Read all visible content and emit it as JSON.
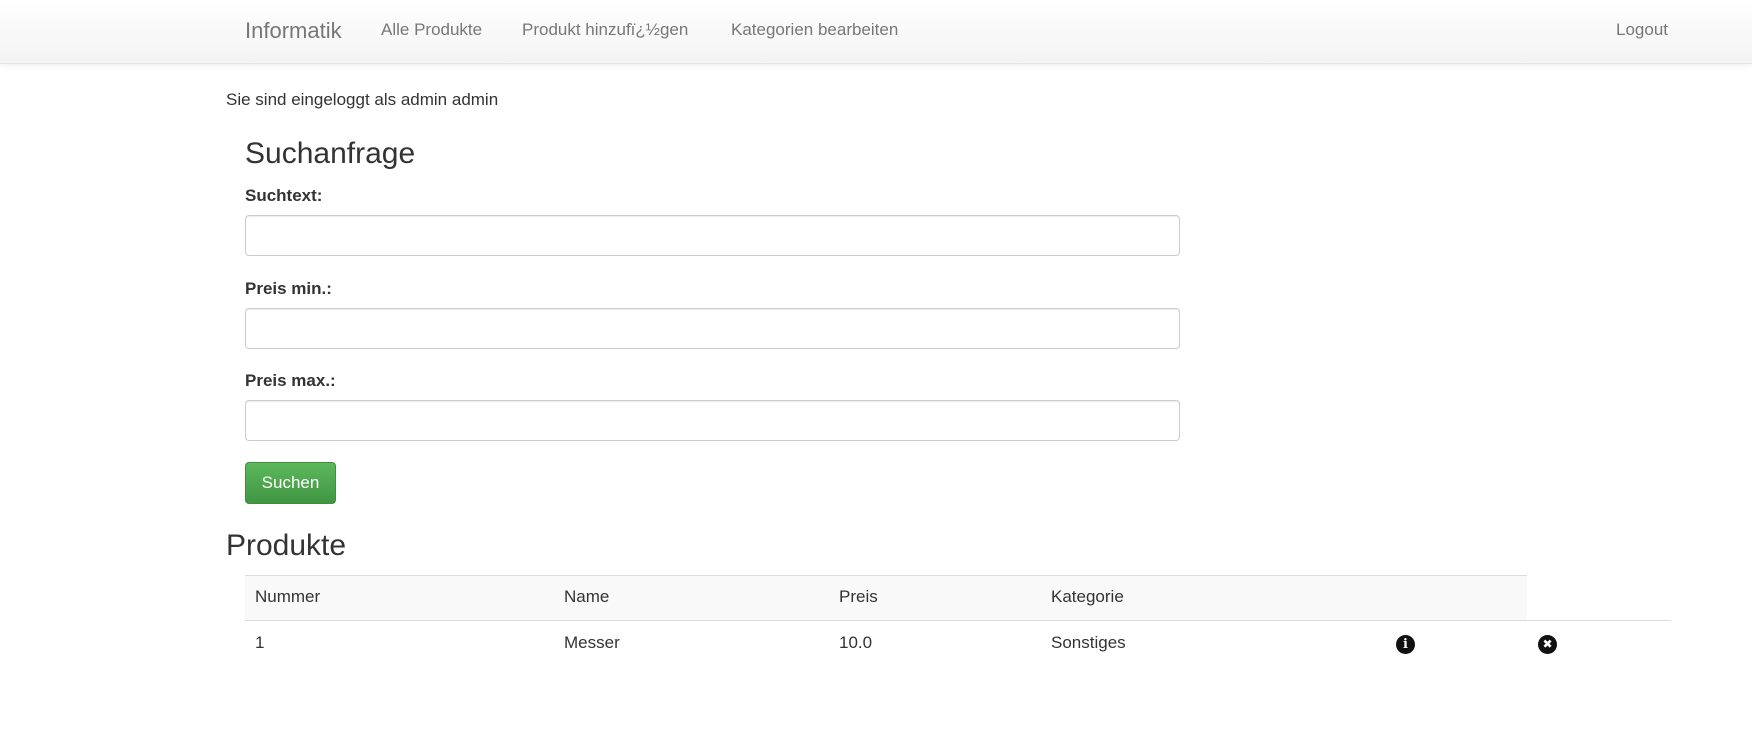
{
  "navbar": {
    "brand": "Informatik",
    "items": [
      "Alle Produkte",
      "Produkt hinzufï¿½gen",
      "Kategorien bearbeiten"
    ],
    "logout": "Logout"
  },
  "login_info": "Sie sind eingeloggt als admin admin",
  "search": {
    "title": "Suchanfrage",
    "text_label": "Suchtext:",
    "text_value": "",
    "min_label": "Preis min.:",
    "min_value": "",
    "max_label": "Preis max.:",
    "max_value": "",
    "button_label": "Suchen",
    "button_color": "#5cb85c"
  },
  "products": {
    "title": "Produkte",
    "columns": [
      "Nummer",
      "Name",
      "Preis",
      "Kategorie"
    ],
    "rows": [
      {
        "nummer": "1",
        "name": "Messer",
        "preis": "10.0",
        "kategorie": "Sonstiges",
        "actions": [
          "info-icon",
          "delete-icon"
        ]
      }
    ]
  }
}
